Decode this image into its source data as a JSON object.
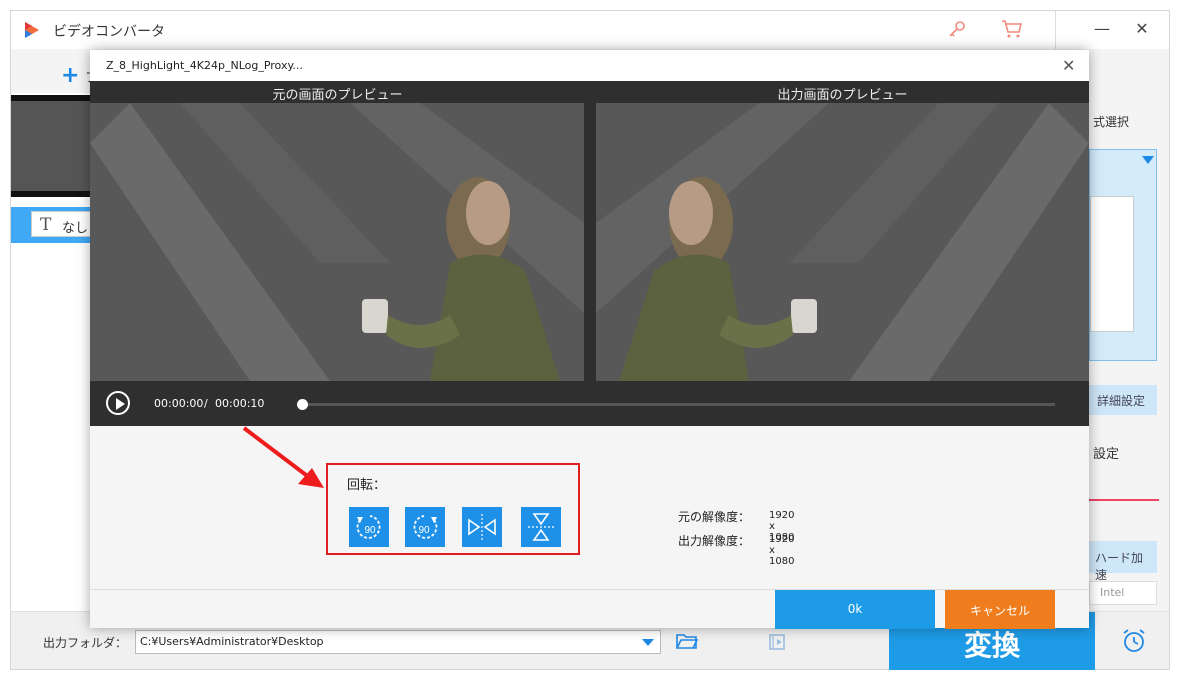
{
  "app": {
    "title": "ビデオコンバータ",
    "add_icon": "plus-icon",
    "add_label": "フ"
  },
  "sidebar": {
    "subtitle_icon": "text-T-icon",
    "subtitle_value": "なし"
  },
  "right_panel": {
    "format_label": "式選択",
    "settings_button": "詳細設定",
    "section_label": "設定",
    "hw_accel_button": "ハード加速",
    "intel_label": "Intel"
  },
  "bottom": {
    "output_folder_label": "出力フォルダ：",
    "output_folder_value": "C:¥Users¥Administrator¥Desktop",
    "convert_button": "変換"
  },
  "dialog": {
    "title": "Z_8_HighLight_4K24p_NLog_Proxy...",
    "preview_original_label": "元の画面のプレビュー",
    "preview_output_label": "出力画面のプレビュー",
    "time_current": "00:00:00",
    "time_separator": "/",
    "time_total": "00:00:10",
    "seek_progress": 0,
    "rotate_label": "回転：",
    "rotate_buttons": [
      {
        "icon": "rotate-ccw-90-icon",
        "text": "90"
      },
      {
        "icon": "rotate-cw-90-icon",
        "text": "90"
      },
      {
        "icon": "flip-horizontal-icon"
      },
      {
        "icon": "flip-vertical-icon"
      }
    ],
    "original_resolution_label": "元の解像度：",
    "original_resolution_value": "1920 x 1080",
    "output_resolution_label": "出力解像度：",
    "output_resolution_value": "1920 x 1080",
    "ok_button": "0k",
    "cancel_button": "キャンセル"
  },
  "colors": {
    "accent_blue": "#1e9be6",
    "cancel_orange": "#f07d1d",
    "highlight_red": "#e02020"
  }
}
